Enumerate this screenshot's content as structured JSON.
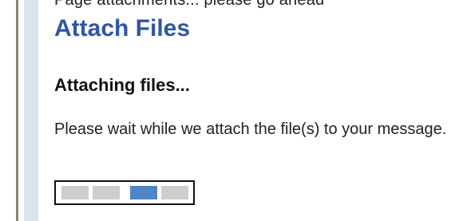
{
  "window": {
    "cutoff_text": "Page attachments... please go ahead"
  },
  "header": {
    "title": "Attach Files"
  },
  "status": {
    "heading": "Attaching files...",
    "message": "Please wait while we attach the file(s) to your message."
  },
  "progress": {
    "segment_count": 4,
    "active_segment": 3,
    "colors": {
      "inactive": "#cdcdcd",
      "active": "#4f86c6",
      "border": "#111111"
    }
  },
  "theme": {
    "title_color": "#2f56a5",
    "sidebar_color": "#dbe3f0",
    "divider_color": "#8d8370"
  }
}
